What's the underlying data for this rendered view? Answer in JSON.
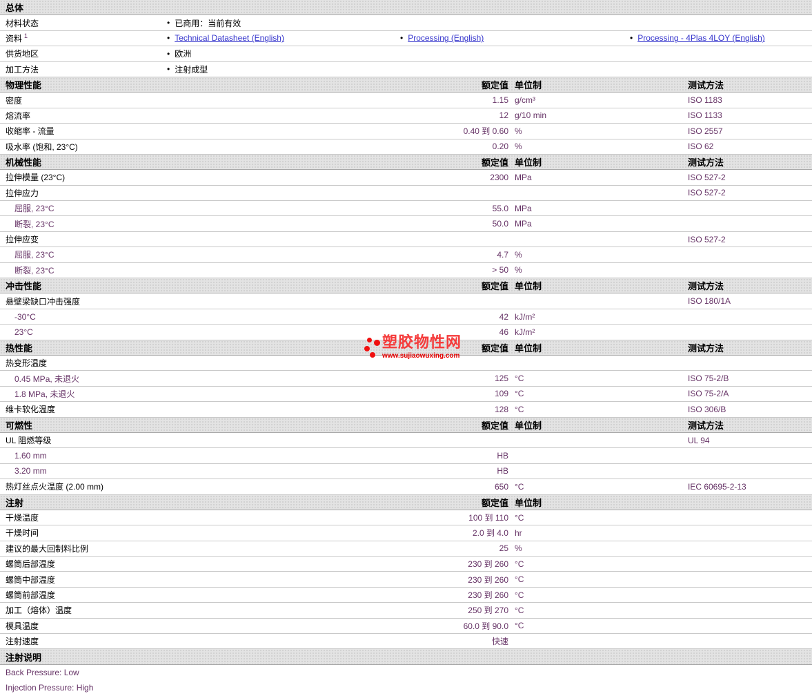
{
  "bullet": "•",
  "columns": {
    "value": "额定值",
    "unit": "单位制",
    "test": "测试方法"
  },
  "logo": {
    "title": "塑胶物性网",
    "url": "www.sujiaowuxing.com"
  },
  "general": {
    "title": "总体",
    "rows": [
      {
        "label": "材料状态",
        "items": [
          {
            "text": "已商用：当前有效",
            "link": false
          }
        ]
      },
      {
        "label": "资料",
        "sup": "1",
        "items": [
          {
            "text": "Technical Datasheet (English)",
            "link": true
          },
          {
            "text": "Processing (English)",
            "link": true
          },
          {
            "text": "Processing - 4Plas 4LOY (English)",
            "link": true
          }
        ]
      },
      {
        "label": "供货地区",
        "items": [
          {
            "text": "欧洲",
            "link": false
          }
        ]
      },
      {
        "label": "加工方法",
        "items": [
          {
            "text": "注射成型",
            "link": false
          }
        ]
      }
    ]
  },
  "sections": [
    {
      "title": "物理性能",
      "show_test": true,
      "rows": [
        {
          "label": "密度",
          "value": "1.15",
          "unit": "g/cm³",
          "test": "ISO 1183"
        },
        {
          "label": "熔流率",
          "value": "12",
          "unit": "g/10 min",
          "test": "ISO 1133"
        },
        {
          "label": "收缩率 - 流量",
          "value": "0.40 到 0.60",
          "unit": "%",
          "test": "ISO 2557"
        },
        {
          "label": "吸水率 (饱和, 23°C)",
          "value": "0.20",
          "unit": "%",
          "test": "ISO 62"
        }
      ]
    },
    {
      "title": "机械性能",
      "show_test": true,
      "rows": [
        {
          "label": "拉伸模量 (23°C)",
          "value": "2300",
          "unit": "MPa",
          "test": "ISO 527-2"
        },
        {
          "label": "拉伸应力",
          "test": "ISO 527-2"
        },
        {
          "label": "屈服, 23°C",
          "indent": 1,
          "value": "55.0",
          "unit": "MPa"
        },
        {
          "label": "断裂, 23°C",
          "indent": 1,
          "value": "50.0",
          "unit": "MPa"
        },
        {
          "label": "拉伸应变",
          "test": "ISO 527-2"
        },
        {
          "label": "屈服, 23°C",
          "indent": 1,
          "value": "4.7",
          "unit": "%"
        },
        {
          "label": "断裂, 23°C",
          "indent": 1,
          "value": "> 50",
          "unit": "%"
        }
      ]
    },
    {
      "title": "冲击性能",
      "show_test": true,
      "rows": [
        {
          "label": "悬壁梁缺口冲击强度",
          "test": "ISO 180/1A"
        },
        {
          "label": "-30°C",
          "indent": 1,
          "value": "42",
          "unit": "kJ/m²"
        },
        {
          "label": "23°C",
          "indent": 1,
          "value": "46",
          "unit": "kJ/m²"
        }
      ]
    },
    {
      "title": "热性能",
      "show_test": true,
      "rows": [
        {
          "label": "热变形温度"
        },
        {
          "label": "0.45 MPa, 未退火",
          "indent": 1,
          "value": "125",
          "unit": "°C",
          "test": "ISO 75-2/B"
        },
        {
          "label": "1.8 MPa, 未退火",
          "indent": 1,
          "value": "109",
          "unit": "°C",
          "test": "ISO 75-2/A"
        },
        {
          "label": "维卡软化温度",
          "value": "128",
          "unit": "°C",
          "test": "ISO 306/B"
        }
      ]
    },
    {
      "title": "可燃性",
      "show_test": true,
      "rows": [
        {
          "label": "UL 阻燃等级",
          "test": "UL 94"
        },
        {
          "label": "1.60 mm",
          "indent": 1,
          "value": "HB"
        },
        {
          "label": "3.20 mm",
          "indent": 1,
          "value": "HB"
        },
        {
          "label": "热灯丝点火温度 (2.00 mm)",
          "value": "650",
          "unit": "°C",
          "test": "IEC 60695-2-13"
        }
      ]
    },
    {
      "title": "注射",
      "show_test": false,
      "rows": [
        {
          "label": "干燥温度",
          "value": "100 到 110",
          "unit": "°C"
        },
        {
          "label": "干燥时间",
          "value": "2.0 到 4.0",
          "unit": "hr"
        },
        {
          "label": "建议的最大回制料比例",
          "value": "25",
          "unit": "%"
        },
        {
          "label": "螺筒后部温度",
          "value": "230 到 260",
          "unit": "°C"
        },
        {
          "label": "螺筒中部温度",
          "value": "230 到 260",
          "unit": "°C"
        },
        {
          "label": "螺筒前部温度",
          "value": "230 到 260",
          "unit": "°C"
        },
        {
          "label": "加工（熔体）温度",
          "value": "250 到 270",
          "unit": "°C"
        },
        {
          "label": "模具温度",
          "value": "60.0 到 90.0",
          "unit": "°C"
        },
        {
          "label": "注射速度",
          "value": "快速"
        }
      ]
    }
  ],
  "notes": {
    "title": "注射说明",
    "lines": [
      "Back Pressure: Low",
      "Injection Pressure: High"
    ]
  }
}
